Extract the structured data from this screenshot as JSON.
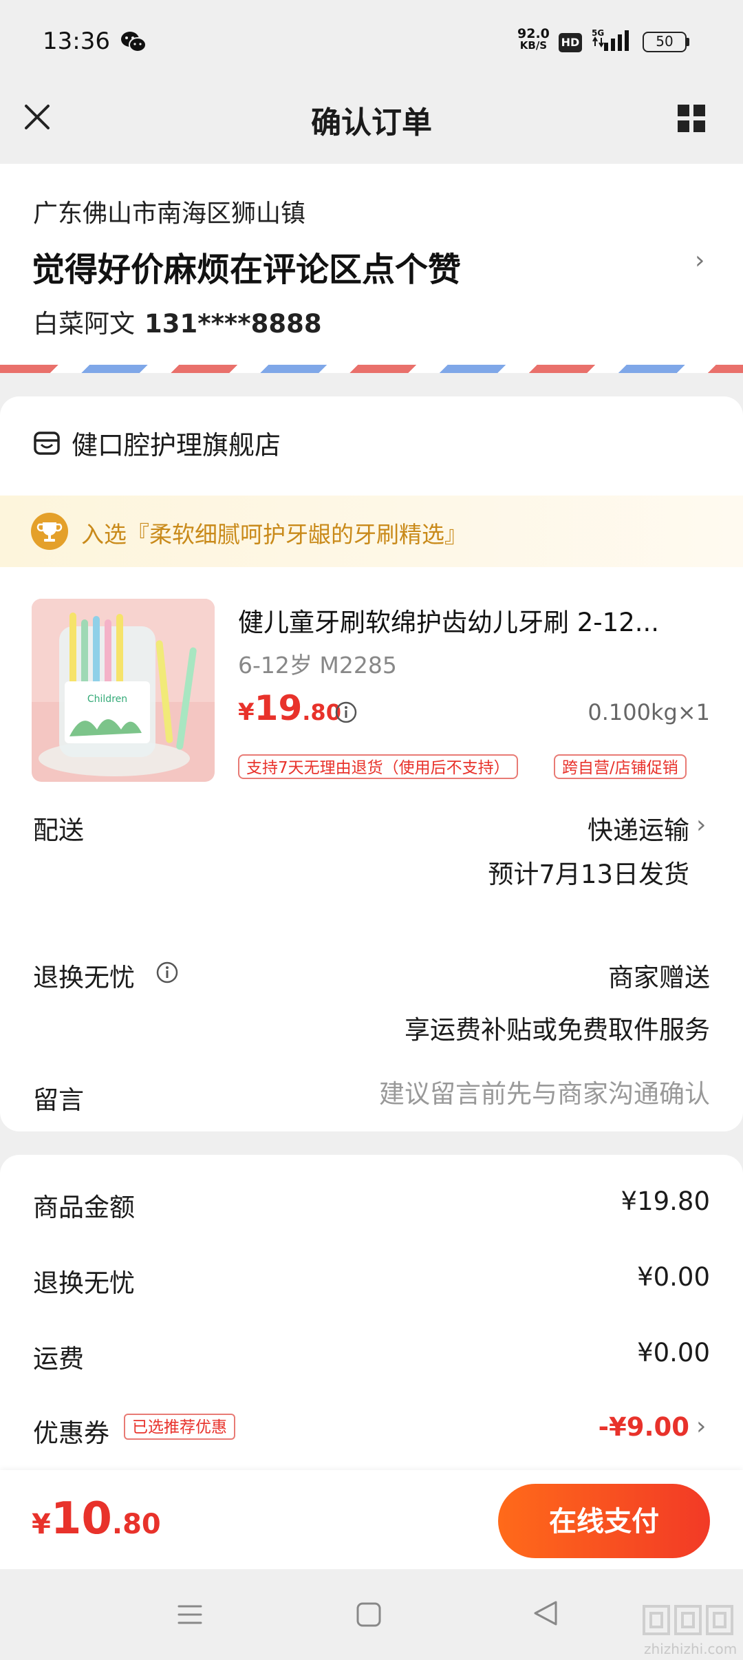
{
  "status_bar": {
    "time": "13:36",
    "net_speed_value": "92.0",
    "net_speed_unit": "KB/S",
    "hd_badge": "HD",
    "network": "5G",
    "battery": "50"
  },
  "header": {
    "title": "确认订单",
    "icons": [
      "close-icon",
      "grid-icon"
    ]
  },
  "address": {
    "region": "广东佛山市南海区狮山镇",
    "detail": "觉得好价麻烦在评论区点个赞",
    "name": "白菜阿文",
    "phone": "131****8888"
  },
  "store": {
    "name": "健口腔护理旗舰店",
    "banner": "入选『柔软细腻呵护牙龈的牙刷精选』"
  },
  "product": {
    "title": "健儿童牙刷软绵护齿幼儿牙刷 2-12...",
    "spec": "6-12岁  M2285",
    "price_symbol": "¥",
    "price_int": "19",
    "price_dec": ".80",
    "weight": "0.100kg×1",
    "tags": [
      "支持7天无理由退货（使用后不支持）",
      "跨自营/店铺促销"
    ]
  },
  "delivery": {
    "label": "配送",
    "method": "快递运输",
    "date": "预计7月13日发货"
  },
  "return_service": {
    "label": "退换无忧",
    "value": "商家赠送",
    "desc": "享运费补贴或免费取件服务"
  },
  "note": {
    "label": "留言",
    "placeholder": "建议留言前先与商家沟通确认"
  },
  "summary": {
    "goods_label": "商品金额",
    "goods_value": "¥19.80",
    "return_label": "退换无忧",
    "return_value": "¥0.00",
    "shipping_label": "运费",
    "shipping_value": "¥0.00",
    "coupon_label": "优惠券",
    "coupon_badge": "已选推荐优惠",
    "coupon_value": "-¥9.00"
  },
  "footer": {
    "total_symbol": "¥",
    "total_int": "10",
    "total_dec": ".80",
    "pay_label": "在线支付"
  },
  "watermark": {
    "text": "zhizhizhi.com"
  },
  "colors": {
    "accent_red": "#e8322b",
    "pay_gradient_start": "#ff6a1a",
    "pay_gradient_end": "#f23a26",
    "banner_text": "#c98a1a"
  }
}
